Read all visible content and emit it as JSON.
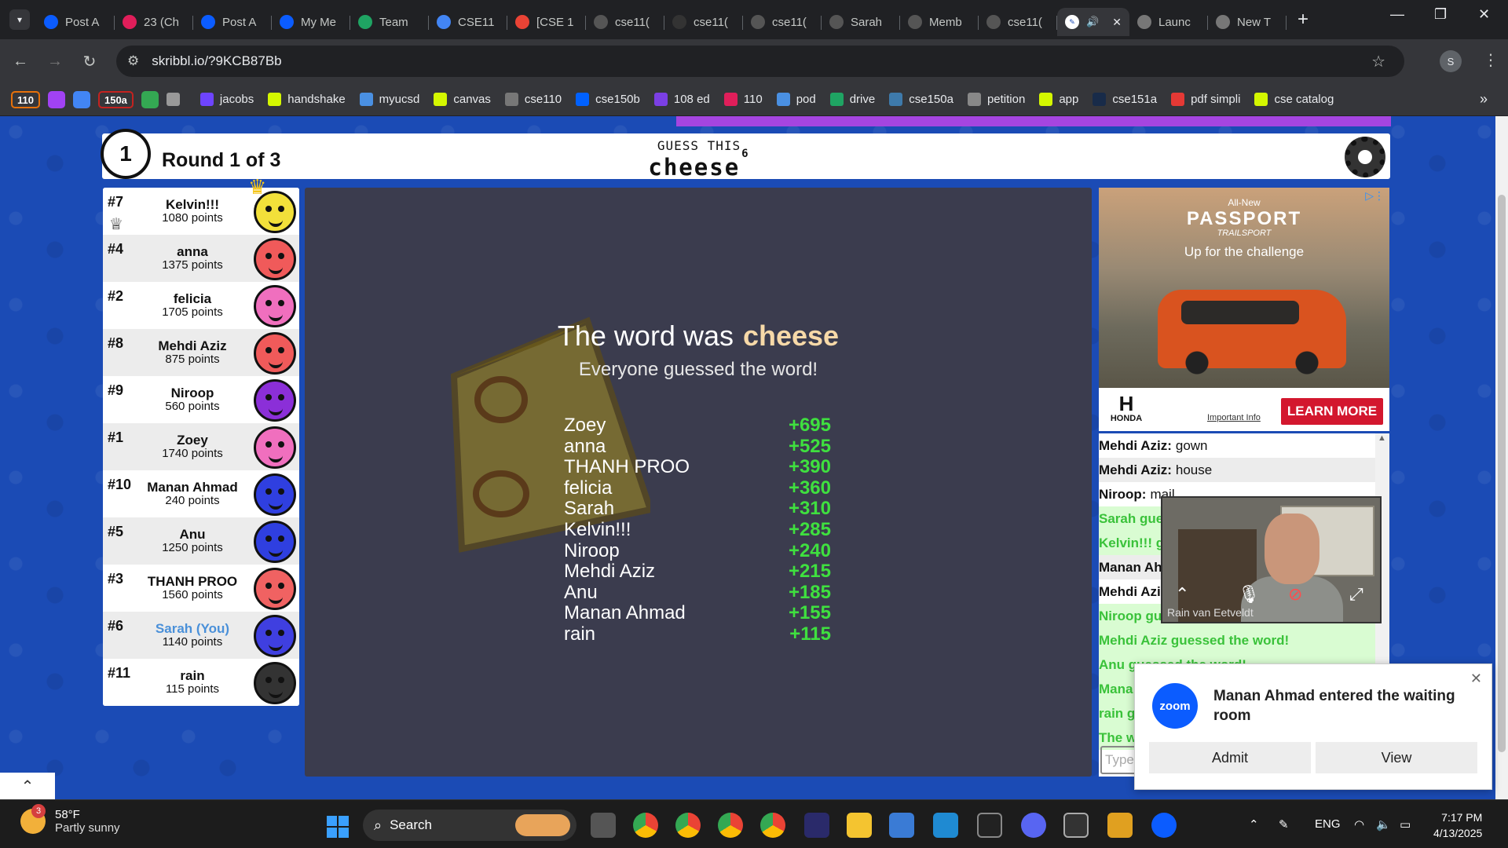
{
  "browser": {
    "tabs": [
      {
        "label": "Post A",
        "icon": "zoom-icon",
        "color": "#0b5cff"
      },
      {
        "label": "23 (Ch",
        "icon": "slack-icon",
        "color": "#e01e5a"
      },
      {
        "label": "Post A",
        "icon": "zoom-icon",
        "color": "#0b5cff"
      },
      {
        "label": "My Me",
        "icon": "zoom-icon",
        "color": "#0b5cff"
      },
      {
        "label": "Team",
        "icon": "drive-icon",
        "color": "#1fa463"
      },
      {
        "label": "CSE11",
        "icon": "docs-icon",
        "color": "#4285f4"
      },
      {
        "label": "[CSE 1",
        "icon": "gmail-icon",
        "color": "#ea4335"
      },
      {
        "label": "cse11(",
        "icon": "github-icon",
        "color": "#555"
      },
      {
        "label": "cse11(",
        "icon": "loading-icon",
        "color": "#333"
      },
      {
        "label": "cse11(",
        "icon": "github-icon",
        "color": "#555"
      },
      {
        "label": "Sarah",
        "icon": "github-icon",
        "color": "#555"
      },
      {
        "label": "Memb",
        "icon": "github-icon",
        "color": "#555"
      },
      {
        "label": "cse11(",
        "icon": "github-icon",
        "color": "#555"
      }
    ],
    "active_tab": {
      "label": "",
      "icon": "skribbl-icon"
    },
    "tabs_after": [
      {
        "label": "Launc",
        "icon": "globe-icon",
        "color": "#777"
      },
      {
        "label": "New T",
        "icon": "chrome-icon",
        "color": "#777"
      }
    ],
    "url": "skribbl.io/?9KCB87Bb",
    "profile_initial": "S",
    "bookmarks": [
      {
        "label": "110",
        "icon": "chip",
        "color": "#e8710a"
      },
      {
        "label": "",
        "icon": "chip-purple",
        "color": "#a142f4"
      },
      {
        "label": "",
        "icon": "chip-blue",
        "color": "#4285f4"
      },
      {
        "label": "150a",
        "icon": "chip",
        "color": "#c5221f"
      },
      {
        "label": "",
        "icon": "chip-green",
        "color": "#34a853"
      },
      {
        "label": "",
        "icon": "apps-icon",
        "color": "#999"
      },
      {
        "label": "jacobs",
        "icon": "jacobs-icon",
        "color": "#6e44ff"
      },
      {
        "label": "handshake",
        "icon": "handshake-icon",
        "color": "#d4f700"
      },
      {
        "label": "myucsd",
        "icon": "myucsd-icon",
        "color": "#4a90e2"
      },
      {
        "label": "canvas",
        "icon": "canvas-icon",
        "color": "#d4f700"
      },
      {
        "label": "cse110",
        "icon": "github-icon",
        "color": "#777"
      },
      {
        "label": "cse150b",
        "icon": "dropbox-icon",
        "color": "#0061ff"
      },
      {
        "label": "108 ed",
        "icon": "ed-icon",
        "color": "#7b3fe4"
      },
      {
        "label": "110",
        "icon": "slack-icon",
        "color": "#e01e5a"
      },
      {
        "label": "pod",
        "icon": "pod-icon",
        "color": "#4a90e2"
      },
      {
        "label": "drive",
        "icon": "drive-icon",
        "color": "#1fa463"
      },
      {
        "label": "cse150a",
        "icon": "piazza-icon",
        "color": "#3e7aab"
      },
      {
        "label": "petition",
        "icon": "petition-icon",
        "color": "#888"
      },
      {
        "label": "app",
        "icon": "app-icon",
        "color": "#d4f700"
      },
      {
        "label": "cse151a",
        "icon": "ucsd-icon",
        "color": "#182b49"
      },
      {
        "label": "pdf simpli",
        "icon": "pdf-icon",
        "color": "#e53935"
      },
      {
        "label": "cse catalog",
        "icon": "catalog-icon",
        "color": "#d4f700"
      }
    ]
  },
  "game": {
    "round_number": "1",
    "round_label": "Round 1 of 3",
    "guess_label": "GUESS THIS",
    "guess_word": "cheese",
    "guess_word_length": "6",
    "players": [
      {
        "rank": "#7",
        "name": "Kelvin!!!",
        "points": "1080 points",
        "avatar_color": "#f2e03a",
        "crown": true,
        "you": false
      },
      {
        "rank": "#4",
        "name": "anna",
        "points": "1375 points",
        "avatar_color": "#f05a5a",
        "crown": false,
        "you": false
      },
      {
        "rank": "#2",
        "name": "felicia",
        "points": "1705 points",
        "avatar_color": "#f06fbe",
        "crown": false,
        "you": false
      },
      {
        "rank": "#8",
        "name": "Mehdi Aziz",
        "points": "875 points",
        "avatar_color": "#f05a5a",
        "crown": false,
        "you": false
      },
      {
        "rank": "#9",
        "name": "Niroop",
        "points": "560 points",
        "avatar_color": "#8b2fd8",
        "crown": false,
        "you": false
      },
      {
        "rank": "#1",
        "name": "Zoey",
        "points": "1740 points",
        "avatar_color": "#f06fbe",
        "crown": false,
        "you": false
      },
      {
        "rank": "#10",
        "name": "Manan Ahmad",
        "points": "240 points",
        "avatar_color": "#2f3fe0",
        "crown": false,
        "you": false
      },
      {
        "rank": "#5",
        "name": "Anu",
        "points": "1250 points",
        "avatar_color": "#2f3fe0",
        "crown": false,
        "you": false
      },
      {
        "rank": "#3",
        "name": "THANH PROO",
        "points": "1560 points",
        "avatar_color": "#f06262",
        "crown": false,
        "you": false
      },
      {
        "rank": "#6",
        "name": "Sarah (You)",
        "points": "1140 points",
        "avatar_color": "#3f3fe0",
        "crown": false,
        "you": true
      },
      {
        "rank": "#11",
        "name": "rain",
        "points": "115 points",
        "avatar_color": "#333333",
        "crown": false,
        "you": false
      }
    ],
    "overlay": {
      "title_prefix": "The word was",
      "word": "cheese",
      "subtitle": "Everyone guessed the word!",
      "results": [
        {
          "name": "Zoey",
          "points": "+695"
        },
        {
          "name": "anna",
          "points": "+525"
        },
        {
          "name": "THANH PROO",
          "points": "+390"
        },
        {
          "name": "felicia",
          "points": "+360"
        },
        {
          "name": "Sarah",
          "points": "+310"
        },
        {
          "name": "Kelvin!!!",
          "points": "+285"
        },
        {
          "name": "Niroop",
          "points": "+240"
        },
        {
          "name": "Mehdi Aziz",
          "points": "+215"
        },
        {
          "name": "Anu",
          "points": "+185"
        },
        {
          "name": "Manan Ahmad",
          "points": "+155"
        },
        {
          "name": "rain",
          "points": "+115"
        }
      ]
    },
    "chat": [
      {
        "author": "Mehdi Aziz:",
        "text": "gown",
        "guessed": false
      },
      {
        "author": "Mehdi Aziz:",
        "text": "house",
        "guessed": false
      },
      {
        "author": "Niroop:",
        "text": "mail",
        "guessed": false
      },
      {
        "author": "",
        "text": "Sarah gue",
        "guessed": true
      },
      {
        "author": "",
        "text": "Kelvin!!! g",
        "guessed": true
      },
      {
        "author": "Manan Ah",
        "text": "",
        "guessed": false
      },
      {
        "author": "Mehdi Azi",
        "text": "",
        "guessed": false
      },
      {
        "author": "",
        "text": "Niroop gu",
        "guessed": true
      },
      {
        "author": "",
        "text": "Mehdi Aziz guessed the word!",
        "guessed": true
      },
      {
        "author": "",
        "text": "Anu guessed the word!",
        "guessed": true
      },
      {
        "author": "",
        "text": "Mana",
        "guessed": true
      },
      {
        "author": "",
        "text": "rain g",
        "guessed": true
      },
      {
        "author": "",
        "text": "The w",
        "guessed": true
      }
    ],
    "chat_placeholder": "Type"
  },
  "ad": {
    "all_new": "All-New",
    "headline": "PASSPORT",
    "trail": "TRAILSPORT",
    "tagline": "Up for the challenge",
    "brand": "HONDA",
    "important_info": "Important Info",
    "cta": "LEARN MORE"
  },
  "video": {
    "participant_name": "Rain van Eetveldt"
  },
  "zoom_notification": {
    "logo_text": "zoom",
    "message": "Manan Ahmad entered the waiting room",
    "admit_label": "Admit",
    "view_label": "View"
  },
  "taskbar": {
    "weather_badge": "3",
    "temperature": "58°F",
    "condition": "Partly sunny",
    "search_label": "Search",
    "language": "ENG",
    "time": "7:17 PM",
    "date": "4/13/2025"
  }
}
